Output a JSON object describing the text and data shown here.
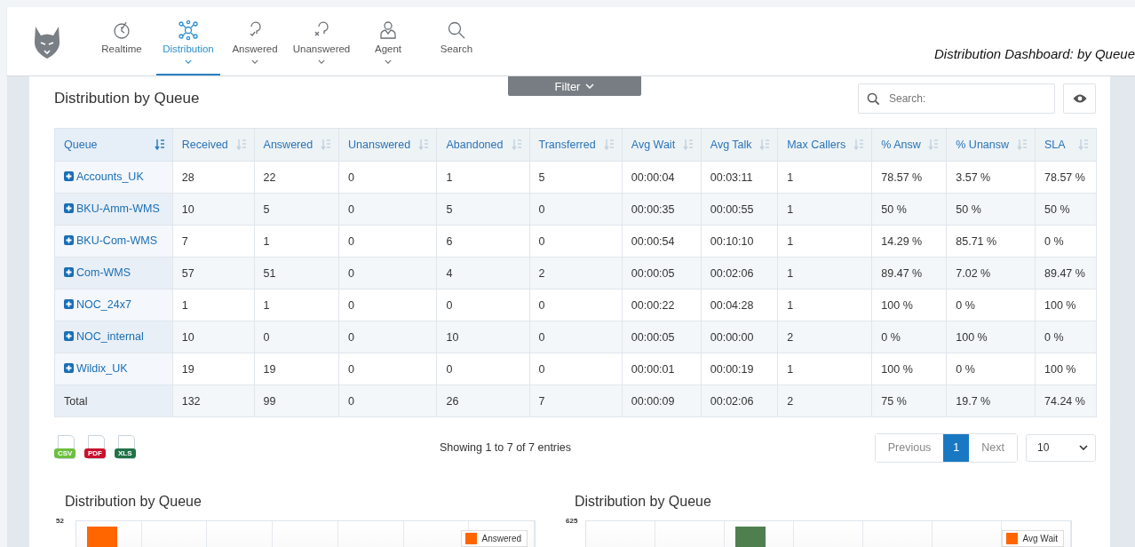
{
  "nav": [
    {
      "label": "Realtime",
      "selected": false,
      "dropdown": false
    },
    {
      "label": "Distribution",
      "selected": true,
      "dropdown": true
    },
    {
      "label": "Answered",
      "selected": false,
      "dropdown": true
    },
    {
      "label": "Unanswered",
      "selected": false,
      "dropdown": true
    },
    {
      "label": "Agent",
      "selected": false,
      "dropdown": true
    },
    {
      "label": "Search",
      "selected": false,
      "dropdown": false
    }
  ],
  "page_title": "Distribution Dashboard: by Queue",
  "filter": {
    "label": "Filter"
  },
  "section_title": "Distribution by Queue",
  "search": {
    "placeholder": "Search:"
  },
  "table": {
    "columns": [
      {
        "label": "Queue",
        "sorted": true
      },
      {
        "label": "Received",
        "sorted": false
      },
      {
        "label": "Answered",
        "sorted": false
      },
      {
        "label": "Unanswered",
        "sorted": false
      },
      {
        "label": "Abandoned",
        "sorted": false
      },
      {
        "label": "Transferred",
        "sorted": false
      },
      {
        "label": "Avg Wait",
        "sorted": false
      },
      {
        "label": "Avg Talk",
        "sorted": false
      },
      {
        "label": "Max Callers",
        "sorted": false
      },
      {
        "label": "% Answ",
        "sorted": false
      },
      {
        "label": "% Unansw",
        "sorted": false
      },
      {
        "label": "SLA",
        "sorted": false
      }
    ],
    "rows": [
      {
        "kind": "queue",
        "cells": [
          "Accounts_UK",
          "28",
          "22",
          "0",
          "1",
          "5",
          "00:00:04",
          "00:03:11",
          "1",
          "78.57 %",
          "3.57 %",
          "78.57 %"
        ]
      },
      {
        "kind": "queue",
        "cells": [
          "BKU-Amm-WMS",
          "10",
          "5",
          "0",
          "5",
          "0",
          "00:00:35",
          "00:00:55",
          "1",
          "50 %",
          "50 %",
          "50 %"
        ]
      },
      {
        "kind": "queue",
        "cells": [
          "BKU-Com-WMS",
          "7",
          "1",
          "0",
          "6",
          "0",
          "00:00:54",
          "00:10:10",
          "1",
          "14.29 %",
          "85.71 %",
          "0 %"
        ]
      },
      {
        "kind": "queue",
        "cells": [
          "Com-WMS",
          "57",
          "51",
          "0",
          "4",
          "2",
          "00:00:05",
          "00:02:06",
          "1",
          "89.47 %",
          "7.02 %",
          "89.47 %"
        ]
      },
      {
        "kind": "queue",
        "cells": [
          "NOC_24x7",
          "1",
          "1",
          "0",
          "0",
          "0",
          "00:00:22",
          "00:04:28",
          "1",
          "100 %",
          "0 %",
          "100 %"
        ]
      },
      {
        "kind": "queue",
        "cells": [
          "NOC_internal",
          "10",
          "0",
          "0",
          "10",
          "0",
          "00:00:05",
          "00:00:00",
          "2",
          "0 %",
          "100 %",
          "0 %"
        ]
      },
      {
        "kind": "queue",
        "cells": [
          "Wildix_UK",
          "19",
          "19",
          "0",
          "0",
          "0",
          "00:00:01",
          "00:00:19",
          "1",
          "100 %",
          "0 %",
          "100 %"
        ]
      },
      {
        "kind": "total",
        "cells": [
          "Total",
          "132",
          "99",
          "0",
          "26",
          "7",
          "00:00:09",
          "00:02:06",
          "2",
          "75 %",
          "19.7 %",
          "74.24 %"
        ]
      }
    ]
  },
  "exports": [
    {
      "label": "CSV",
      "color": "#6cbf3f"
    },
    {
      "label": "PDF",
      "color": "#c8102e"
    },
    {
      "label": "XLS",
      "color": "#217346"
    }
  ],
  "info": "Showing 1 to 7 of 7 entries",
  "pagination": {
    "previous": "Previous",
    "pages": [
      {
        "label": "1",
        "selected": true
      }
    ],
    "next": "Next"
  },
  "page_size": "10",
  "charts": [
    {
      "title": "Distribution by Queue",
      "top_tick": "52",
      "legend": {
        "label": "Answered",
        "color": "#ff6600"
      }
    },
    {
      "title": "Distribution by Queue",
      "top_tick": "625",
      "legend": {
        "label": "Avg Wait",
        "color": "#ff6600"
      }
    }
  ]
}
